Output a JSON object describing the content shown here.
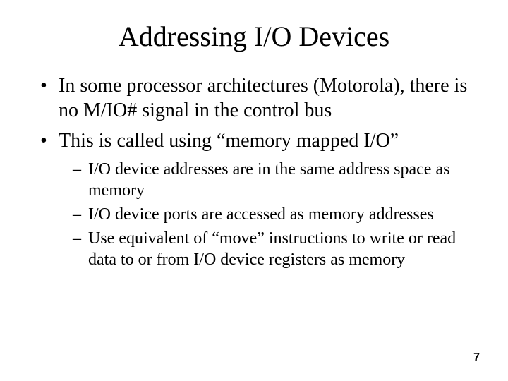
{
  "title": "Addressing I/O Devices",
  "bullets": {
    "b1": "In some processor architectures (Motorola), there is no M/IO# signal in the control bus",
    "b2": "This is called using “memory mapped I/O”"
  },
  "subBullets": {
    "s1": "I/O device addresses are in the same address space as memory",
    "s2": "I/O device ports are accessed as memory addresses",
    "s3": "Use equivalent of “move” instructions to write or read data to or from I/O device registers as memory"
  },
  "pageNumber": "7"
}
